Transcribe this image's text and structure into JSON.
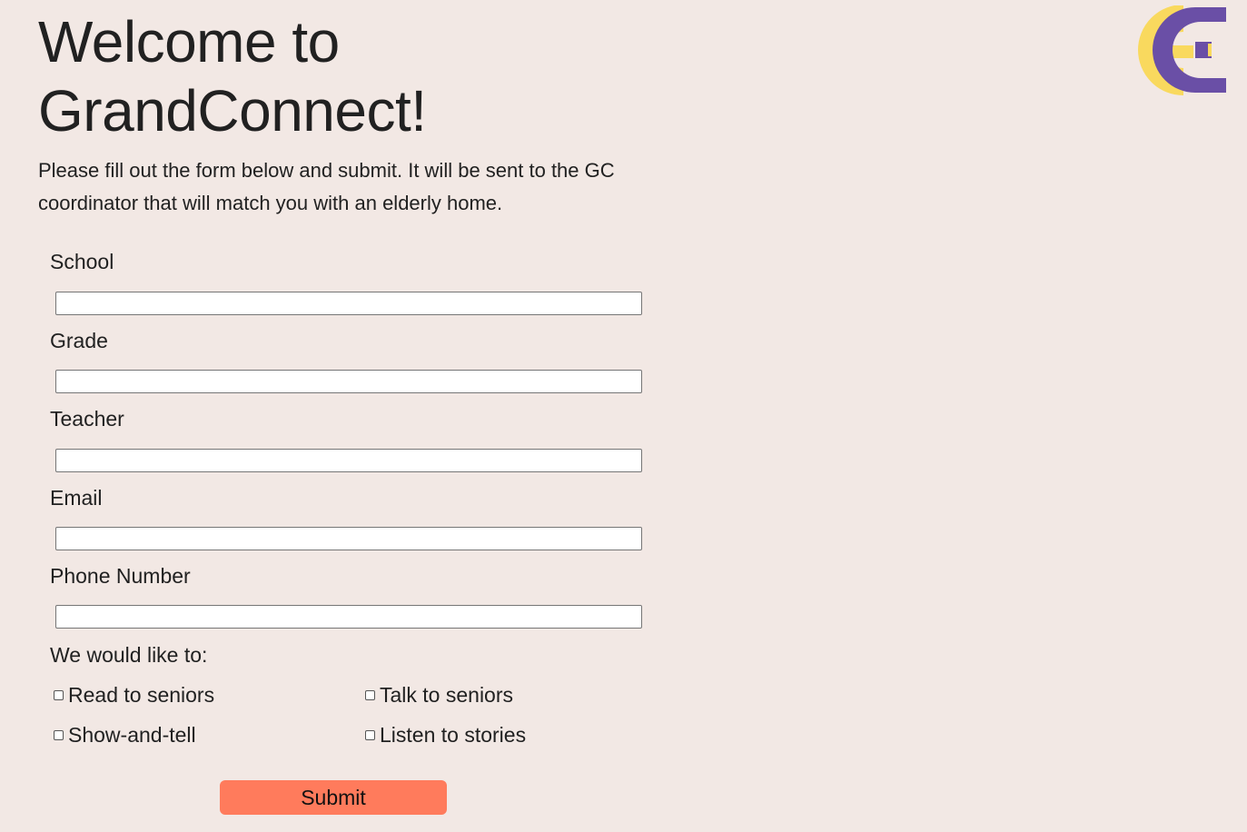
{
  "header": {
    "title_line1": "Welcome to",
    "title_line2": "GrandConnect!",
    "intro": "Please fill out the form below and submit. It will be sent to the GC coordinator that will match you with an elderly home."
  },
  "logo": {
    "icon": "gc-logo-icon",
    "colors": {
      "yellow": "#f9d95e",
      "purple": "#6a4fa6"
    }
  },
  "form": {
    "fields": [
      {
        "label": "School",
        "value": "",
        "placeholder": ""
      },
      {
        "label": "Grade",
        "value": "",
        "placeholder": ""
      },
      {
        "label": "Teacher",
        "value": "",
        "placeholder": ""
      },
      {
        "label": "Email",
        "value": "",
        "placeholder": ""
      },
      {
        "label": "Phone Number",
        "value": "",
        "placeholder": ""
      }
    ],
    "options_label": "We would like to:",
    "options": [
      {
        "label": "Read to seniors",
        "checked": false
      },
      {
        "label": "Talk to seniors",
        "checked": false
      },
      {
        "label": "Show-and-tell",
        "checked": false
      },
      {
        "label": "Listen to stories",
        "checked": false
      }
    ],
    "submit_label": "Submit"
  },
  "colors": {
    "background": "#f2e8e4",
    "submit_button": "#ff7b5c",
    "text": "#212121"
  }
}
